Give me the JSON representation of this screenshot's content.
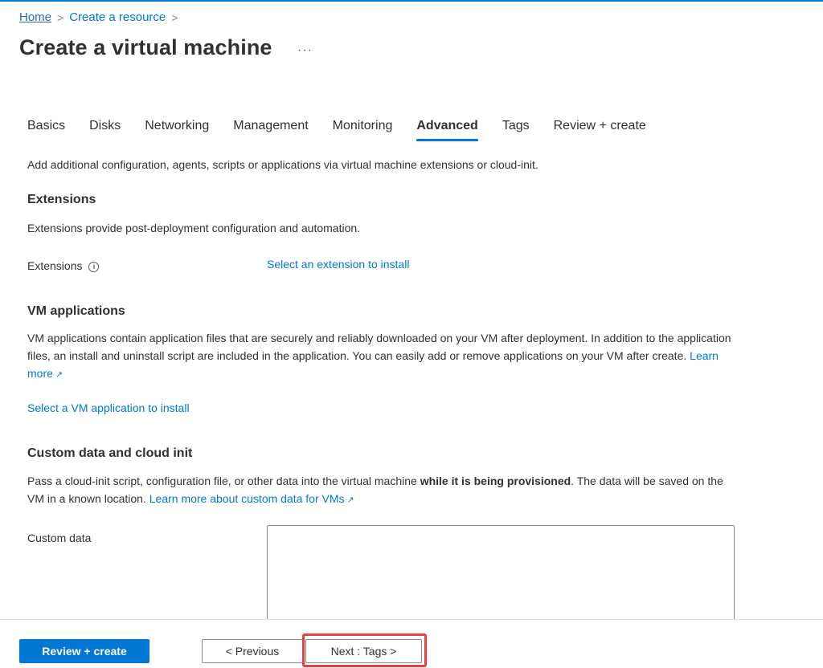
{
  "breadcrumb": {
    "items": [
      "Home",
      "Create a resource"
    ],
    "separator": ">"
  },
  "header": {
    "title": "Create a virtual machine",
    "more_label": "···"
  },
  "tabs": [
    {
      "label": "Basics",
      "active": false
    },
    {
      "label": "Disks",
      "active": false
    },
    {
      "label": "Networking",
      "active": false
    },
    {
      "label": "Management",
      "active": false
    },
    {
      "label": "Monitoring",
      "active": false
    },
    {
      "label": "Advanced",
      "active": true
    },
    {
      "label": "Tags",
      "active": false
    },
    {
      "label": "Review + create",
      "active": false
    }
  ],
  "intro": "Add additional configuration, agents, scripts or applications via virtual machine extensions or cloud-init.",
  "extensions": {
    "heading": "Extensions",
    "description": "Extensions provide post-deployment configuration and automation.",
    "field_label": "Extensions",
    "info_icon": "i",
    "link": "Select an extension to install"
  },
  "vm_applications": {
    "heading": "VM applications",
    "description": "VM applications contain application files that are securely and reliably downloaded on your VM after deployment. In addition to the application files, an install and uninstall script are included in the application. You can easily add or remove applications on your VM after create.",
    "learn_more": "Learn more",
    "link": "Select a VM application to install"
  },
  "custom_data": {
    "heading": "Custom data and cloud init",
    "description_before": "Pass a cloud-init script, configuration file, or other data into the virtual machine ",
    "description_bold": "while it is being provisioned",
    "description_after": ". The data will be saved on the VM in a known location.",
    "learn_more": "Learn more about custom data for VMs",
    "field_label": "Custom data",
    "value": ""
  },
  "footer": {
    "review_create": "Review + create",
    "previous": "< Previous",
    "next": "Next : Tags >"
  },
  "colors": {
    "accent": "#0078d4",
    "highlight": "#e8403f"
  }
}
